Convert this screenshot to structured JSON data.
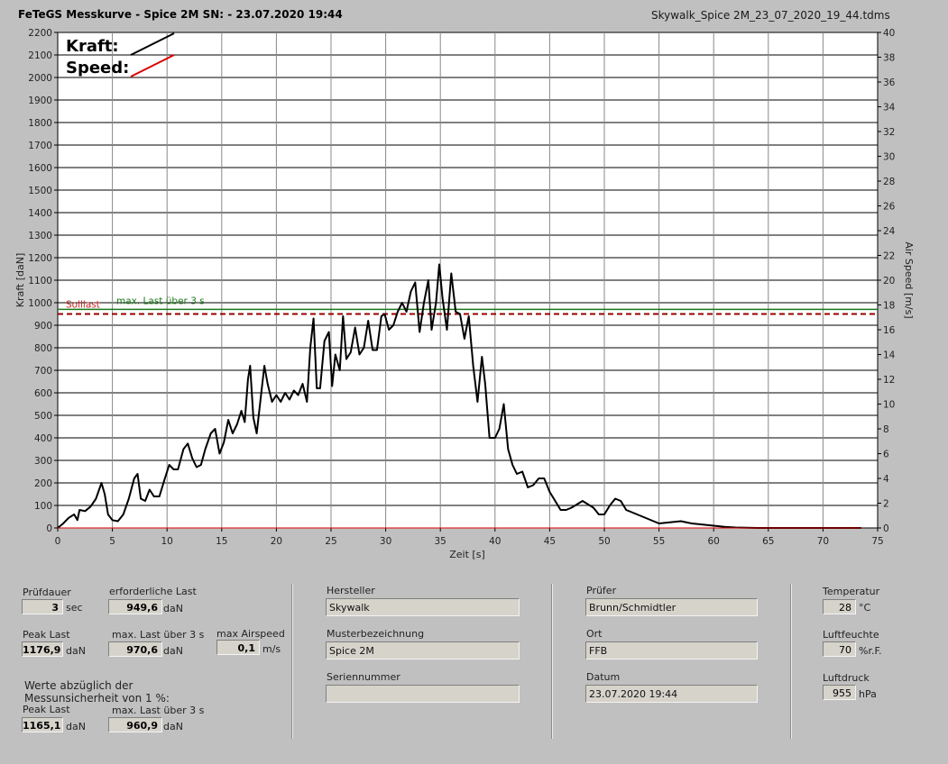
{
  "header": {
    "title": "FeTeGS Messkurve - Spice 2M  SN:  - 23.07.2020 19:44",
    "filename": "Skywalk_Spice 2M_23_07_2020_19_44.tdms"
  },
  "chart_data": {
    "type": "line",
    "xlabel": "Zeit [s]",
    "ylabel": "Kraft [daN]",
    "y2label": "Air Speed [m/s]",
    "xlim": [
      0,
      75
    ],
    "ylim": [
      0,
      2200
    ],
    "y2lim": [
      0,
      40
    ],
    "x_ticks": [
      0,
      5,
      10,
      15,
      20,
      25,
      30,
      35,
      40,
      45,
      50,
      55,
      60,
      65,
      70,
      75
    ],
    "y_ticks": [
      0,
      100,
      200,
      300,
      400,
      500,
      600,
      700,
      800,
      900,
      1000,
      1100,
      1200,
      1300,
      1400,
      1500,
      1600,
      1700,
      1800,
      1900,
      2000,
      2100,
      2200
    ],
    "y2_ticks": [
      0,
      2,
      4,
      6,
      8,
      10,
      12,
      14,
      16,
      18,
      20,
      22,
      24,
      26,
      28,
      30,
      32,
      34,
      36,
      38,
      40
    ],
    "grid": true,
    "legend": {
      "position": "top-left",
      "kraft_label": "Kraft:",
      "speed_label": "Speed:",
      "kraft_color": "#000000",
      "speed_color": "#dd0000"
    },
    "annotations": {
      "sollast_label": "Solllast",
      "sollast_value": 950,
      "maxlast_label": "max. Last über  3 s",
      "maxlast_value": 970.6,
      "sollast_color": "#990000",
      "maxlast_color": "#1a7a1a"
    },
    "series": [
      {
        "name": "Kraft",
        "color": "#000000",
        "points": [
          [
            0,
            0
          ],
          [
            0.5,
            20
          ],
          [
            1,
            45
          ],
          [
            1.5,
            60
          ],
          [
            1.8,
            35
          ],
          [
            2,
            80
          ],
          [
            2.5,
            75
          ],
          [
            3,
            95
          ],
          [
            3.5,
            130
          ],
          [
            4,
            200
          ],
          [
            4.3,
            150
          ],
          [
            4.6,
            60
          ],
          [
            5,
            35
          ],
          [
            5.5,
            30
          ],
          [
            6,
            60
          ],
          [
            6.5,
            130
          ],
          [
            7,
            220
          ],
          [
            7.3,
            240
          ],
          [
            7.6,
            130
          ],
          [
            8,
            120
          ],
          [
            8.4,
            170
          ],
          [
            8.8,
            140
          ],
          [
            9.3,
            140
          ],
          [
            9.8,
            220
          ],
          [
            10.2,
            280
          ],
          [
            10.6,
            260
          ],
          [
            11,
            260
          ],
          [
            11.5,
            350
          ],
          [
            11.9,
            375
          ],
          [
            12.3,
            310
          ],
          [
            12.7,
            270
          ],
          [
            13.1,
            280
          ],
          [
            13.5,
            350
          ],
          [
            14,
            420
          ],
          [
            14.4,
            440
          ],
          [
            14.8,
            330
          ],
          [
            15.2,
            380
          ],
          [
            15.6,
            480
          ],
          [
            16,
            420
          ],
          [
            16.4,
            460
          ],
          [
            16.8,
            520
          ],
          [
            17.1,
            470
          ],
          [
            17.4,
            660
          ],
          [
            17.6,
            720
          ],
          [
            17.9,
            490
          ],
          [
            18.2,
            420
          ],
          [
            18.6,
            590
          ],
          [
            18.9,
            720
          ],
          [
            19.2,
            640
          ],
          [
            19.6,
            560
          ],
          [
            20,
            590
          ],
          [
            20.4,
            560
          ],
          [
            20.8,
            600
          ],
          [
            21.2,
            570
          ],
          [
            21.6,
            610
          ],
          [
            22,
            590
          ],
          [
            22.4,
            640
          ],
          [
            22.8,
            560
          ],
          [
            23.1,
            800
          ],
          [
            23.4,
            930
          ],
          [
            23.7,
            620
          ],
          [
            24,
            620
          ],
          [
            24.4,
            830
          ],
          [
            24.8,
            870
          ],
          [
            25.1,
            630
          ],
          [
            25.4,
            770
          ],
          [
            25.8,
            700
          ],
          [
            26.1,
            940
          ],
          [
            26.4,
            750
          ],
          [
            26.8,
            780
          ],
          [
            27.2,
            890
          ],
          [
            27.6,
            770
          ],
          [
            28,
            800
          ],
          [
            28.4,
            920
          ],
          [
            28.8,
            790
          ],
          [
            29.2,
            790
          ],
          [
            29.6,
            940
          ],
          [
            29.9,
            950
          ],
          [
            30.3,
            880
          ],
          [
            30.7,
            900
          ],
          [
            31.1,
            960
          ],
          [
            31.5,
            1000
          ],
          [
            31.9,
            960
          ],
          [
            32.3,
            1050
          ],
          [
            32.7,
            1090
          ],
          [
            33.1,
            870
          ],
          [
            33.5,
            1000
          ],
          [
            33.9,
            1100
          ],
          [
            34.2,
            880
          ],
          [
            34.6,
            1000
          ],
          [
            34.9,
            1170
          ],
          [
            35.2,
            1020
          ],
          [
            35.6,
            880
          ],
          [
            36,
            1130
          ],
          [
            36.4,
            960
          ],
          [
            36.8,
            950
          ],
          [
            37.2,
            840
          ],
          [
            37.6,
            940
          ],
          [
            38,
            720
          ],
          [
            38.4,
            560
          ],
          [
            38.8,
            760
          ],
          [
            39.1,
            640
          ],
          [
            39.5,
            400
          ],
          [
            40,
            400
          ],
          [
            40.4,
            440
          ],
          [
            40.8,
            550
          ],
          [
            41.2,
            350
          ],
          [
            41.6,
            280
          ],
          [
            42,
            240
          ],
          [
            42.5,
            250
          ],
          [
            43,
            180
          ],
          [
            43.5,
            190
          ],
          [
            44,
            220
          ],
          [
            44.5,
            220
          ],
          [
            45,
            160
          ],
          [
            45.5,
            120
          ],
          [
            46,
            80
          ],
          [
            46.5,
            80
          ],
          [
            47,
            90
          ],
          [
            48,
            120
          ],
          [
            49,
            90
          ],
          [
            49.5,
            60
          ],
          [
            50,
            60
          ],
          [
            50.5,
            100
          ],
          [
            51,
            130
          ],
          [
            51.5,
            120
          ],
          [
            52,
            80
          ],
          [
            53,
            60
          ],
          [
            54,
            40
          ],
          [
            55,
            20
          ],
          [
            56,
            25
          ],
          [
            57,
            30
          ],
          [
            58,
            20
          ],
          [
            59,
            15
          ],
          [
            60,
            10
          ],
          [
            61,
            5
          ],
          [
            62,
            2
          ],
          [
            64,
            0
          ],
          [
            68,
            0
          ],
          [
            73.5,
            0
          ]
        ]
      },
      {
        "name": "Speed",
        "color": "#dd0000",
        "points": [
          [
            0,
            0
          ],
          [
            73.5,
            0
          ]
        ]
      }
    ]
  },
  "panel": {
    "pruefdauer_label": "Prüfdauer",
    "pruefdauer_value": "3",
    "pruefdauer_unit": "sec",
    "erf_last_label": "erforderliche Last",
    "erf_last_value": "949,6",
    "erf_last_unit": "daN",
    "peak_last_label": "Peak Last",
    "peak_last_value": "1176,9",
    "peak_last_unit": "daN",
    "max_last_label": "max. Last über  3 s",
    "max_last_value": "970,6",
    "max_last_unit": "daN",
    "max_airspeed_label": "max Airspeed",
    "max_airspeed_value": "0,1",
    "max_airspeed_unit": "m/s",
    "werte_line1": "Werte abzüglich der",
    "werte_line2": "Messunsicherheit von 1   %:",
    "peak_last2_label": "Peak Last",
    "peak_last2_value": "1165,1",
    "peak_last2_unit": "daN",
    "max_last2_label": "max. Last über  3 s",
    "max_last2_value": "960,9",
    "max_last2_unit": "daN",
    "hersteller_label": "Hersteller",
    "hersteller_value": "Skywalk",
    "muster_label": "Musterbezeichnung",
    "muster_value": "Spice 2M",
    "serien_label": "Seriennummer",
    "serien_value": "",
    "pruefer_label": "Prüfer",
    "pruefer_value": "Brunn/Schmidtler",
    "ort_label": "Ort",
    "ort_value": "FFB",
    "datum_label": "Datum",
    "datum_value": "23.07.2020 19:44",
    "temp_label": "Temperatur",
    "temp_value": "28",
    "temp_unit": "°C",
    "feuchte_label": "Luftfeuchte",
    "feuchte_value": "70",
    "feuchte_unit": "%r.F.",
    "druck_label": "Luftdruck",
    "druck_value": "955",
    "druck_unit": "hPa"
  }
}
